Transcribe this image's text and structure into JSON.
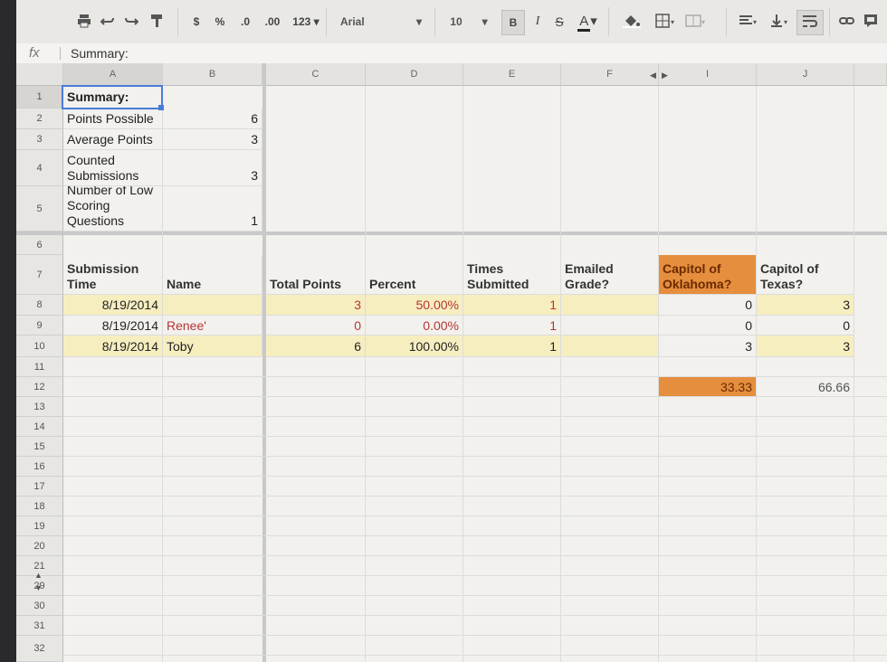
{
  "toolbar": {
    "number_formats": {
      "currency": "$",
      "percent": "%",
      "decrease_decimals": ".0",
      "increase_decimals": ".00",
      "more_formats": "123"
    },
    "font": "Arial",
    "font_size": "10",
    "bold": "B",
    "italic": "I",
    "strikethrough": "S",
    "text_color": "A"
  },
  "formula_bar": {
    "fx_label": "fx",
    "value": "Summary:"
  },
  "columns": [
    "A",
    "B",
    "C",
    "D",
    "E",
    "F",
    "I",
    "J"
  ],
  "rows": [
    "1",
    "2",
    "3",
    "4",
    "5",
    "6",
    "7",
    "8",
    "9",
    "10",
    "11",
    "12",
    "13",
    "14",
    "15",
    "16",
    "17",
    "18",
    "19",
    "20",
    "21",
    "29",
    "30",
    "31",
    "32"
  ],
  "summary": {
    "title": "Summary:",
    "points_possible_label": "Points Possible",
    "points_possible": "6",
    "average_points_label": "Average Points",
    "average_points": "3",
    "counted_label": "Counted Submissions",
    "counted": "3",
    "low_scoring_label": "Number of Low Scoring Questions",
    "low_scoring": "1"
  },
  "headers": {
    "submission_time": "Submission Time",
    "name": "Name",
    "total_points": "Total Points",
    "percent": "Percent",
    "times_submitted": "Times Submitted",
    "emailed_grade": "Emailed Grade?",
    "capitol_oklahoma": "Capitol of Oklahoma?",
    "capitol_texas": "Capitol of Texas?"
  },
  "data_rows": [
    {
      "time": "8/19/2014",
      "name": "",
      "total": "3",
      "percent": "50.00%",
      "times": "1",
      "ok": "0",
      "tx": "3"
    },
    {
      "time": "8/19/2014",
      "name": "Renee'",
      "total": "0",
      "percent": "0.00%",
      "times": "1",
      "ok": "0",
      "tx": "0"
    },
    {
      "time": "8/19/2014",
      "name": "Toby",
      "total": "6",
      "percent": "100.00%",
      "times": "1",
      "ok": "3",
      "tx": "3"
    }
  ],
  "question_pct": {
    "oklahoma": "33.33",
    "texas": "66.66"
  },
  "colors": {
    "highlight_yellow": "#f7eec0",
    "highlight_orange": "#e58e3e",
    "low_score_red": "#b53535",
    "selection_blue": "#4a7bd8"
  }
}
